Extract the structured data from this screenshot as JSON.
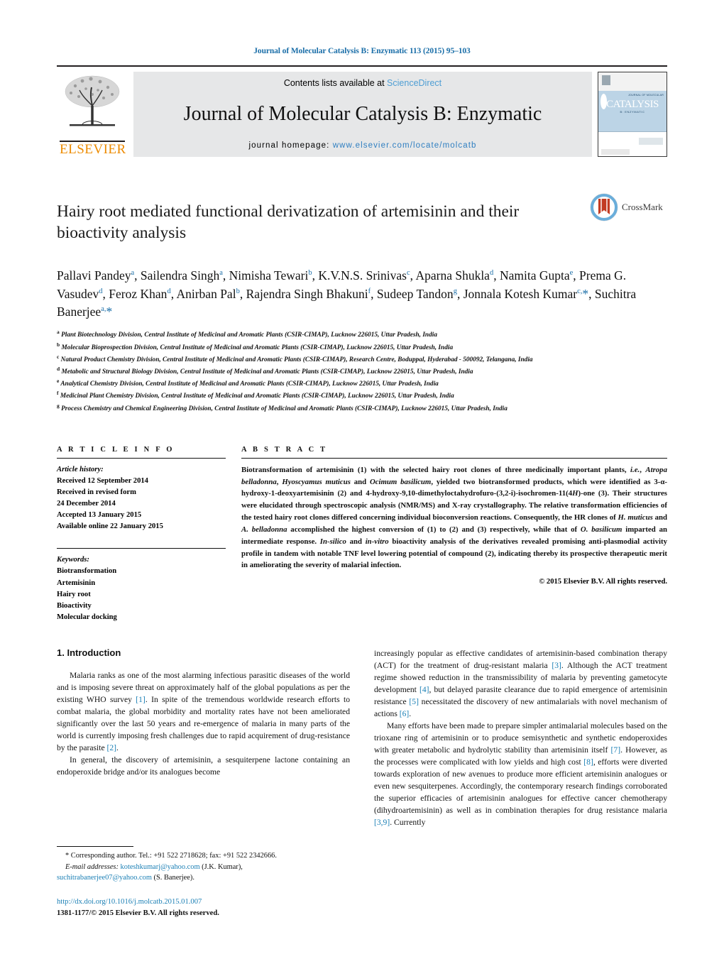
{
  "running_head": "Journal of Molecular Catalysis B: Enzymatic 113 (2015) 95–103",
  "masthead": {
    "contents_prefix": "Contents lists available at ",
    "sciencedirect": "ScienceDirect",
    "journal_title": "Journal of Molecular Catalysis B: Enzymatic",
    "homepage_prefix": "journal homepage: ",
    "homepage_url": "www.elsevier.com/locate/molcatb",
    "publisher": "ELSEVIER",
    "cover_line1": "JOURNAL OF MOLECULAR",
    "cover_line2": "CATALYSIS",
    "cover_line3": "B: ENZYMATIC"
  },
  "article": {
    "title": "Hairy root mediated functional derivatization of artemisinin and their bioactivity analysis",
    "crossmark_label": "CrossMark",
    "authors_html": "Pallavi Pandey<sup>a</sup>, Sailendra Singh<sup>a</sup>, Nimisha Tewari<sup>b</sup>, K.V.N.S. Srinivas<sup>c</sup>, Aparna Shukla<sup>d</sup>, Namita Gupta<sup>e</sup>, Prema G. Vasudev<sup>d</sup>, Feroz Khan<sup>d</sup>, Anirban Pal<sup>b</sup>, Rajendra Singh Bhakuni<sup>f</sup>, Sudeep Tandon<sup>g</sup>, Jonnala Kotesh Kumar<sup>c,</sup><span class=\"star\">*</span>, Suchitra Banerjee<sup>a,</sup><span class=\"star\">*</span>",
    "affiliations": [
      {
        "marker": "a",
        "text": "Plant Biotechnology Division, Central Institute of Medicinal and Aromatic Plants (CSIR-CIMAP), Lucknow 226015, Uttar Pradesh, India"
      },
      {
        "marker": "b",
        "text": "Molecular Bioprospection Division, Central Institute of Medicinal and Aromatic Plants (CSIR-CIMAP), Lucknow 226015, Uttar Pradesh, India"
      },
      {
        "marker": "c",
        "text": "Natural Product Chemistry Division, Central Institute of Medicinal and Aromatic Plants (CSIR-CIMAP), Research Centre, Boduppal, Hyderabad - 500092, Telangana, India"
      },
      {
        "marker": "d",
        "text": "Metabolic and Structural Biology Division, Central Institute of Medicinal and Aromatic Plants (CSIR-CIMAP), Lucknow 226015, Uttar Pradesh, India"
      },
      {
        "marker": "e",
        "text": "Analytical Chemistry Division, Central Institute of Medicinal and Aromatic Plants (CSIR-CIMAP), Lucknow 226015, Uttar Pradesh, India"
      },
      {
        "marker": "f",
        "text": "Medicinal Plant Chemistry Division, Central Institute of Medicinal and Aromatic Plants (CSIR-CIMAP), Lucknow 226015, Uttar Pradesh, India"
      },
      {
        "marker": "g",
        "text": "Process Chemistry and Chemical Engineering Division, Central Institute of Medicinal and Aromatic Plants (CSIR-CIMAP), Lucknow 226015, Uttar Pradesh, India"
      }
    ]
  },
  "article_info": {
    "heading": "A R T I C L E   I N F O",
    "history_label": "Article history:",
    "history": [
      "Received 12 September 2014",
      "Received in revised form",
      "24 December 2014",
      "Accepted 13 January 2015",
      "Available online 22 January 2015"
    ],
    "keywords_label": "Keywords:",
    "keywords": [
      "Biotransformation",
      "Artemisinin",
      "Hairy root",
      "Bioactivity",
      "Molecular docking"
    ]
  },
  "abstract": {
    "heading": "A B S T R A C T",
    "body_html": "Biotransformation of artemisinin (1) with the selected hairy root clones of three medicinally important plants, <i>i.e.</i>, <i>Atropa belladonna</i>, <i>Hyoscyamus muticus</i> and <i>Ocimum basilicum</i>, yielded two biotransformed products, which were identified as 3-&alpha;-hydroxy-1-deoxyartemisinin (2) and 4-hydroxy-9,10-dimethyloctahydrofuro-(3,2-i)-isochromen-11(4<i>H</i>)-one (3). Their structures were elucidated through spectroscopic analysis (NMR/MS) and X-ray crystallography. The relative transformation efficiencies of the tested hairy root clones differed concerning individual bioconversion reactions. Consequently, the HR clones of <i>H. muticus</i> and <i>A. belladonna</i> accomplished the highest conversion of (1) to (2) and (3) respectively, while that of <i>O. basilicum</i> imparted an intermediate response. <i>In-silico</i> and <i>in-vitro</i> bioactivity analysis of the derivatives revealed promising anti-plasmodial activity profile in tandem with notable TNF level lowering potential of compound (2), indicating thereby its prospective therapeutic merit in ameliorating the severity of malarial infection.",
    "copyright": "© 2015 Elsevier B.V. All rights reserved."
  },
  "introduction": {
    "section_number_title": "1.  Introduction",
    "left_paragraphs_html": [
      "Malaria ranks as one of the most alarming infectious parasitic diseases of the world and is imposing severe threat on approximately half of the global populations as per the existing WHO survey <span class=\"ref\">[1]</span>. In spite of the tremendous worldwide research efforts to combat malaria, the global morbidity and mortality rates have not been ameliorated significantly over the last 50 years and re-emergence of malaria in many parts of the world is currently imposing fresh challenges due to rapid acquirement of drug-resistance by the parasite <span class=\"ref\">[2]</span>.",
      "In general, the discovery of artemisinin, a sesquiterpene lactone containing an endoperoxide bridge and/or its analogues become"
    ],
    "right_paragraphs_html": [
      "increasingly popular as effective candidates of artemisinin-based combination therapy (ACT) for the treatment of drug-resistant malaria <span class=\"ref\">[3]</span>. Although the ACT treatment regime showed reduction in the transmissibility of malaria by preventing gametocyte development <span class=\"ref\">[4]</span>, but delayed parasite clearance due to rapid emergence of artemisinin resistance <span class=\"ref\">[5]</span> necessitated the discovery of new antimalarials with novel mechanism of actions <span class=\"ref\">[6]</span>.",
      "Many efforts have been made to prepare simpler antimalarial molecules based on the trioxane ring of artemisinin or to produce semisynthetic and synthetic endoperoxides with greater metabolic and hydrolytic stability than artemisinin itself <span class=\"ref\">[7]</span>. However, as the processes were complicated with low yields and high cost <span class=\"ref\">[8]</span>, efforts were diverted towards exploration of new avenues to produce more efficient artemisinin analogues or even new sesquiterpenes. Accordingly, the contemporary research findings corroborated the superior efficacies of artemisinin analogues for effective cancer chemotherapy (dihydroartemisinin) as well as in combination therapies for drug resistance malaria <span class=\"ref\">[3,9]</span>. Currently"
    ]
  },
  "footnote": {
    "corresponding_html": "<span class=\"star\">*</span>  Corresponding author. Tel.: +91 522 2718628; fax: +91 522 2342666.",
    "email_label": "E-mail addresses:",
    "email_1": "koteshkumarj@yahoo.com",
    "email_1_owner": "(J.K. Kumar),",
    "email_2": "suchitrabanerjee07@yahoo.com",
    "email_2_owner": "(S. Banerjee).",
    "doi": "http://dx.doi.org/10.1016/j.molcatb.2015.01.007",
    "issn_line": "1381-1177/© 2015 Elsevier B.V. All rights reserved."
  },
  "colors": {
    "link_blue": "#1a7fb5",
    "header_blue": "#1a6ea8",
    "elsevier_orange": "#ED8B00",
    "banner_grey": "#e6e7e8"
  }
}
